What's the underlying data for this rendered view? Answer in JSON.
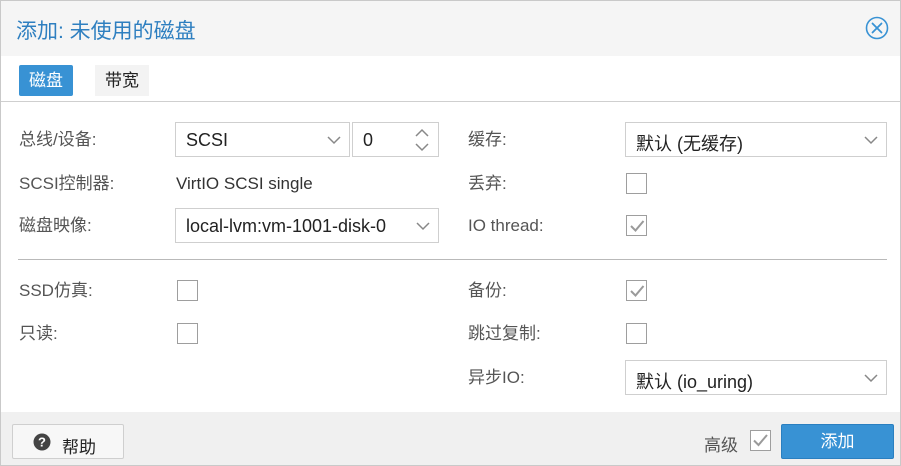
{
  "title": "添加: 未使用的磁盘",
  "tabs": [
    {
      "label": "磁盘",
      "active": true
    },
    {
      "label": "带宽",
      "active": false
    }
  ],
  "left": {
    "bus_device_label": "总线/设备:",
    "bus_value": "SCSI",
    "device_number": "0",
    "scsi_controller_label": "SCSI控制器:",
    "scsi_controller_value": "VirtIO SCSI single",
    "disk_image_label": "磁盘映像:",
    "disk_image_value": "local-lvm:vm-1001-disk-0",
    "ssd_label": "SSD仿真:",
    "ssd_checked": false,
    "readonly_label": "只读:",
    "readonly_checked": false
  },
  "right": {
    "cache_label": "缓存:",
    "cache_value": "默认 (无缓存)",
    "discard_label": "丢弃:",
    "discard_checked": false,
    "iothread_label": "IO thread:",
    "iothread_checked": true,
    "backup_label": "备份:",
    "backup_checked": true,
    "skip_replication_label": "跳过复制:",
    "skip_replication_checked": false,
    "async_io_label": "异步IO:",
    "async_io_value": "默认 (io_uring)"
  },
  "footer": {
    "help_label": "帮助",
    "advanced_label": "高级",
    "advanced_checked": true,
    "add_label": "添加"
  },
  "colors": {
    "accent": "#3892d4",
    "title": "#2e7fc0",
    "checkmark": "#9a9a9a"
  }
}
